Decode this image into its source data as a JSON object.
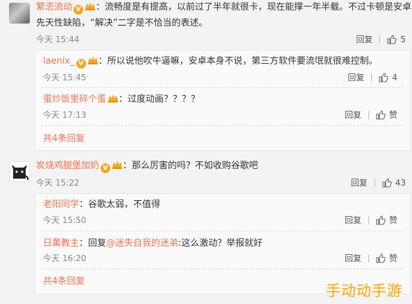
{
  "comments": [
    {
      "user": "繁恣流动",
      "text": "：流畅度是有提高，以前过了半年就很卡，现在能撑一年半载。不过卡顿是安卓的",
      "text2": "先天性缺陷，“解决”二字是不恰当的表述。",
      "time": "今天 15:44",
      "reply": "回复",
      "likes": "5",
      "replies": [
        {
          "user": "laenix_",
          "text": "：所以说他吹牛逼嘛，安卓本身不说，第三方软件要流氓就很难控制。",
          "time": "今天 15:45",
          "reply": "回复",
          "likes": "4"
        },
        {
          "user": "蛋炒饭里碎个蛋",
          "text": "：过度动画？？？？",
          "time": "今天 17:13",
          "reply": "回复",
          "likes": "赞"
        }
      ],
      "more": "共4条回复"
    },
    {
      "user": "炭烧鸡腿堡加奶",
      "text": "：那么厉害的吗？不如收购谷歌吧",
      "time": "今天 15:22",
      "reply": "回复",
      "likes": "43",
      "replies": [
        {
          "user": "老阳同学",
          "text": "：谷歌太弱，不值得",
          "time": "今天 15:50",
          "reply": "回复",
          "likes": "赞"
        },
        {
          "user": "日薰教主",
          "text_pre": "：回复",
          "at": "@迷失自我的迷弟",
          "text": ":这么激动？举报就好",
          "time": "今天 16:20",
          "reply": "回复",
          "likes": "赞"
        }
      ],
      "more": "共4条回复"
    }
  ],
  "watermark": "手动动手游",
  "colors": {
    "username": "#eb7350",
    "badge": "#f5a623",
    "watermark": "#f1b84a"
  }
}
